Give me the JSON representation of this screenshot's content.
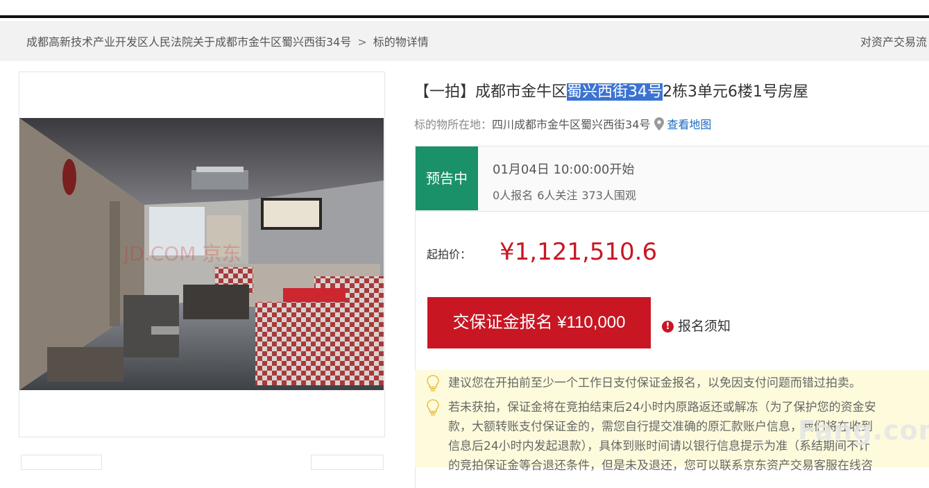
{
  "breadcrumb": {
    "court": "成都高新技术产业开发区人民法院关于成都市金牛区蜀兴西街34号",
    "separator": ">",
    "current": "标的物详情",
    "right_link": "对资产交易流"
  },
  "item": {
    "title_prefix": "【一拍】成都市金牛区",
    "title_highlight": "蜀兴西街34号",
    "title_suffix": "2栋3单元6楼1号房屋",
    "location_label": "标的物所在地：",
    "location_value": "四川成都市金牛区蜀兴西街34号",
    "map_link": "查看地图"
  },
  "photo": {
    "watermark": "JD.COM 京东"
  },
  "auction": {
    "status": "预告中",
    "start_time": "01月04日 10:00:00开始",
    "signups": "0人报名",
    "followers": "6人关注",
    "viewers": "373人围观",
    "price_label": "起拍价：",
    "price": "¥1,121,510.6",
    "deposit_button": "交保证金报名 ¥110,000",
    "notice_link": "报名须知"
  },
  "tips": {
    "tip1": "建议您在开拍前至少一个工作日支付保证金报名，以免因支付问题而错过拍卖。",
    "tip2_line1": "若未获拍，保证金将在竞拍结束后24小时内原路返还或解冻（为了保护您的资金安",
    "tip2_line2": "款，大额转账支付保证金的，需您自行提交准确的原汇款账户信息，我们将在收到",
    "tip2_line3": "信息后24小时内发起退款），具体到账时间请以银行信息提示为准（系结期间不计",
    "tip2_line4": "的竞拍保证金等合退还条件，但是未及退还，您可以联系京东资产交易客服在线咨"
  },
  "site_watermark": "Fang.com",
  "colors": {
    "accent_red": "#c81623",
    "status_green": "#1a9169",
    "link_blue": "#1b6bc5",
    "highlight_blue": "#3b73d1"
  }
}
